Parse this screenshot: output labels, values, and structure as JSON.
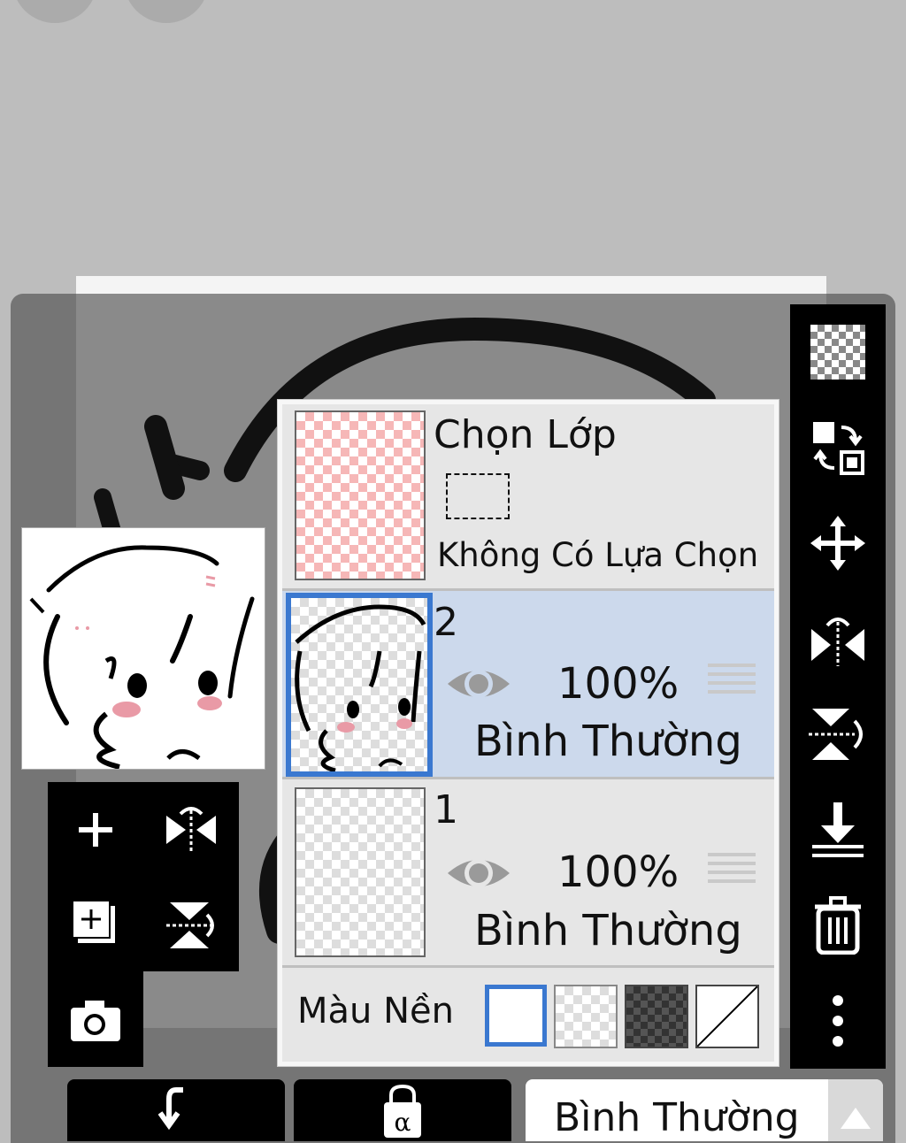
{
  "layer_panel": {
    "selection_layer": {
      "title": "Chọn Lớp",
      "status": "Không Có Lựa Chọn"
    },
    "layers": [
      {
        "name": "2",
        "opacity": "100%",
        "blend": "Bình Thường",
        "visible": true,
        "selected": true
      },
      {
        "name": "1",
        "opacity": "100%",
        "blend": "Bình Thường",
        "visible": true,
        "selected": false
      }
    ],
    "background": {
      "label": "Màu Nền",
      "options": [
        "white",
        "transparent",
        "dark-checker",
        "none"
      ],
      "selected": "white"
    }
  },
  "right_toolbar": [
    "new-transparent-layer-icon",
    "swap-layer-icon",
    "move-icon",
    "flip-horizontal-icon",
    "flip-vertical-icon",
    "merge-down-icon",
    "trash-icon",
    "more-icon"
  ],
  "left_toolbox": [
    "add-layer-icon",
    "flip-layer-horizontal-icon",
    "add-canvas-layer-icon",
    "flip-layer-vertical-icon",
    "camera-icon"
  ],
  "bottom_bar": {
    "blend_mode": "Bình Thường",
    "clip_label": "↲",
    "alpha_lock_label": "α"
  },
  "colors": {
    "selected_row": "#ccd9ec",
    "accent": "#3a78d0",
    "panel": "#757575",
    "toolbar": "#000000"
  }
}
